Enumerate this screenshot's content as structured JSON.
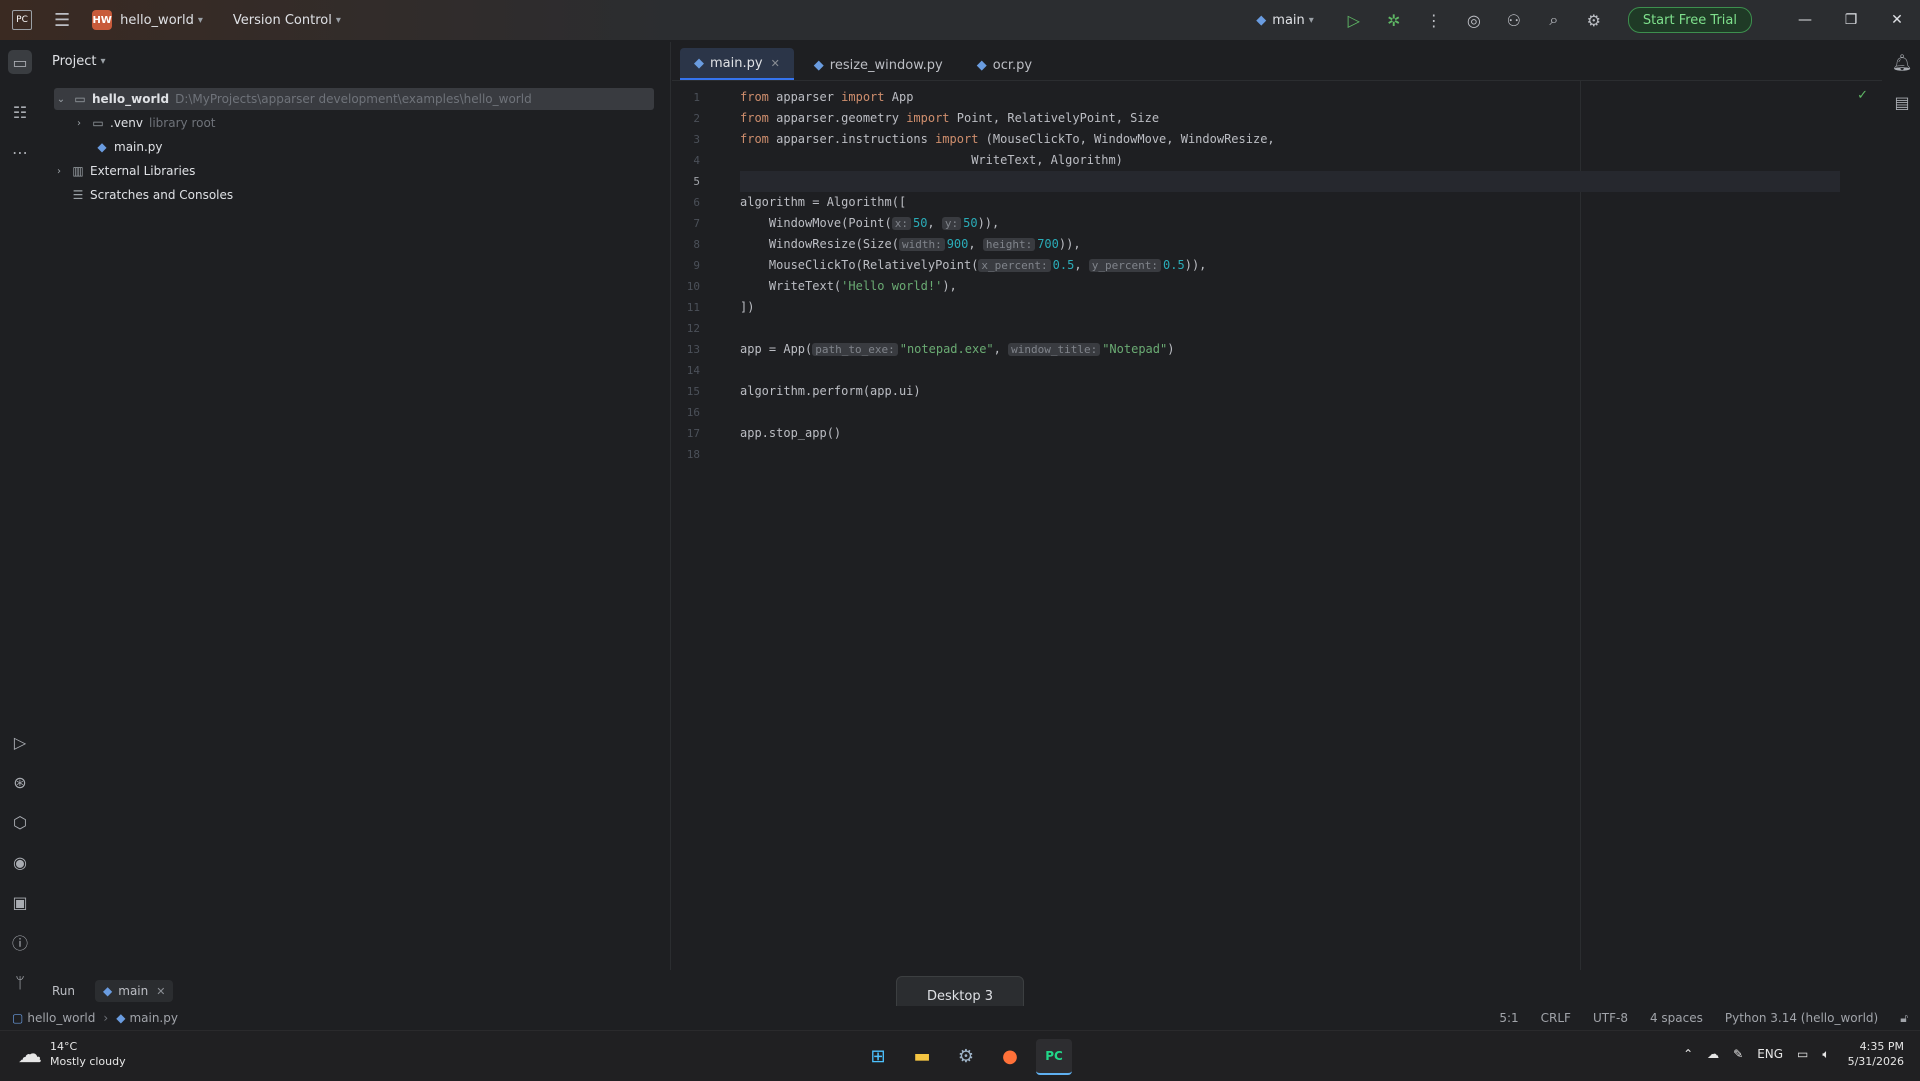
{
  "titlebar": {
    "project_badge": "HW",
    "project_name": "hello_world",
    "vcs": "Version Control",
    "run_config": "main",
    "trial_label": "Start Free Trial"
  },
  "project_panel": {
    "title": "Project",
    "root_name": "hello_world",
    "root_path": "D:\\MyProjects\\apparser development\\examples\\hello_world",
    "venv_name": ".venv",
    "venv_note": "library root",
    "main_file": "main.py",
    "external": "External Libraries",
    "scratches": "Scratches and Consoles"
  },
  "tabs": [
    "main.py",
    "resize_window.py",
    "ocr.py"
  ],
  "code": {
    "l1": [
      "from",
      " apparser ",
      "import",
      " App"
    ],
    "l2": [
      "from",
      " apparser.geometry ",
      "import",
      " Point, RelativelyPoint, Size"
    ],
    "l3": [
      "from",
      " apparser.instructions ",
      "import",
      " (MouseClickTo, WindowMove, WindowResize,"
    ],
    "l4": "                                WriteText, Algorithm)",
    "l6": "algorithm = Algorithm([",
    "l7": {
      "a": "    WindowMove(Point(",
      "h1": "x:",
      "v1": "50",
      "c": ", ",
      "h2": "y:",
      "v2": "50",
      "e": ")),"
    },
    "l8": {
      "a": "    WindowResize(Size(",
      "h1": "width:",
      "v1": "900",
      "c": ", ",
      "h2": "height:",
      "v2": "700",
      "e": ")),"
    },
    "l9": {
      "a": "    MouseClickTo(RelativelyPoint(",
      "h1": "x_percent:",
      "v1": "0.5",
      "c": ", ",
      "h2": "y_percent:",
      "v2": "0.5",
      "e": ")),"
    },
    "l10": {
      "a": "    WriteText(",
      "s": "'Hello world!'",
      "e": "),"
    },
    "l11": "])",
    "l13": {
      "a": "app = App(",
      "h1": "path_to_exe:",
      "s1": "\"notepad.exe\"",
      "c": ", ",
      "h2": "window_title:",
      "s2": "\"Notepad\"",
      "e": ")"
    },
    "l15": "algorithm.perform(app.ui)",
    "l17": "app.stop_app()"
  },
  "line_numbers": [
    "1",
    "2",
    "3",
    "4",
    "5",
    "6",
    "7",
    "8",
    "9",
    "10",
    "11",
    "12",
    "13",
    "14",
    "15",
    "16",
    "17",
    "18"
  ],
  "runbar": {
    "label": "Run",
    "tab": "main"
  },
  "tooltip": "Desktop 3",
  "statusbar": {
    "crumb_project": "hello_world",
    "crumb_file": "main.py",
    "position": "5:1",
    "line_sep": "CRLF",
    "encoding": "UTF-8",
    "indent": "4 spaces",
    "interpreter": "Python 3.14 (hello_world)"
  },
  "taskbar": {
    "temp": "14°C",
    "weather": "Mostly cloudy",
    "lang": "ENG",
    "time": "4:35 PM",
    "date": "5/31/2026"
  }
}
